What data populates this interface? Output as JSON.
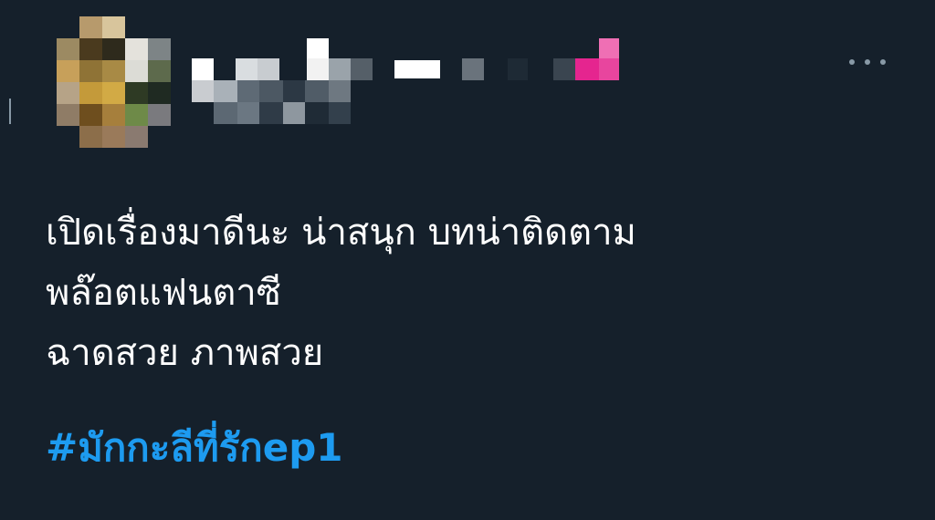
{
  "theme": {
    "background": "#15202b",
    "text": "#ffffff",
    "hashtag_color": "#1d9bf0",
    "muted": "#8899a6"
  },
  "author": {
    "avatar_icon": "pixelated-avatar",
    "name_icon": "pixelated-name"
  },
  "more_icon": "more-horizontal-icon",
  "tweet": {
    "lines": [
      "เปิดเรื่องมาดีนะ น่าสนุก บทน่าติดตาม",
      "พล๊อตแฟนตาซี",
      "ฉาดสวย ภาพสวย"
    ],
    "hashtag": "#มักกะลีที่รักep1"
  }
}
